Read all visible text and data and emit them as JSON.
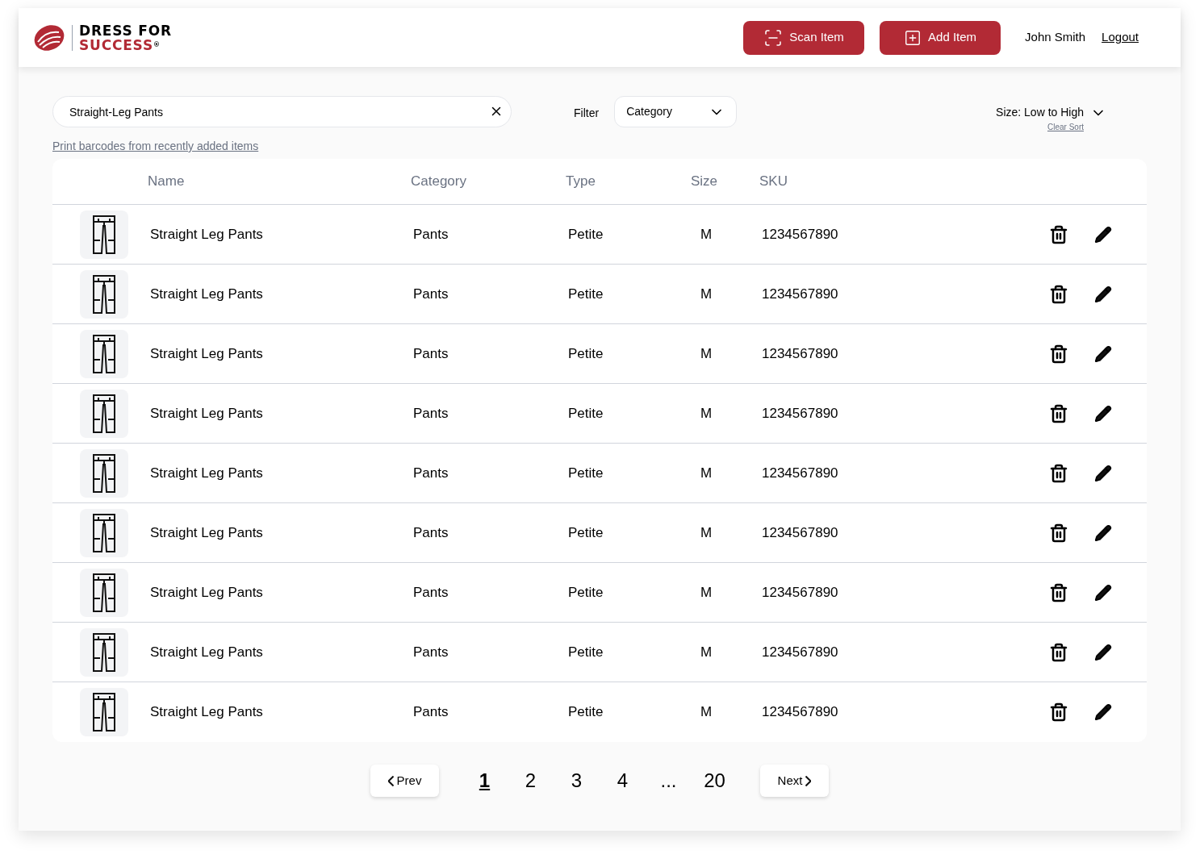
{
  "header": {
    "logo": {
      "line1": "DRESS FOR",
      "line2": "SUCCESS",
      "mark": "®"
    },
    "buttons": [
      {
        "kind": "scan",
        "label": "Scan Item"
      },
      {
        "kind": "add",
        "label": "Add Item"
      }
    ],
    "user": "John Smith",
    "logout": "Logout"
  },
  "search": {
    "value": "Straight-Leg Pants"
  },
  "filter": {
    "label": "Filter",
    "dropdown": "Category"
  },
  "sort": {
    "label": "Size: Low to High",
    "clear": "Clear Sort"
  },
  "print_link": "Print barcodes from recently added items",
  "table": {
    "columns": [
      "Name",
      "Category",
      "Type",
      "Size",
      "SKU"
    ],
    "rows": [
      {
        "name": "Straight Leg Pants",
        "category": "Pants",
        "type": "Petite",
        "size": "M",
        "sku": "1234567890"
      },
      {
        "name": "Straight Leg Pants",
        "category": "Pants",
        "type": "Petite",
        "size": "M",
        "sku": "1234567890"
      },
      {
        "name": "Straight Leg Pants",
        "category": "Pants",
        "type": "Petite",
        "size": "M",
        "sku": "1234567890"
      },
      {
        "name": "Straight Leg Pants",
        "category": "Pants",
        "type": "Petite",
        "size": "M",
        "sku": "1234567890"
      },
      {
        "name": "Straight Leg Pants",
        "category": "Pants",
        "type": "Petite",
        "size": "M",
        "sku": "1234567890"
      },
      {
        "name": "Straight Leg Pants",
        "category": "Pants",
        "type": "Petite",
        "size": "M",
        "sku": "1234567890"
      },
      {
        "name": "Straight Leg Pants",
        "category": "Pants",
        "type": "Petite",
        "size": "M",
        "sku": "1234567890"
      },
      {
        "name": "Straight Leg Pants",
        "category": "Pants",
        "type": "Petite",
        "size": "M",
        "sku": "1234567890"
      },
      {
        "name": "Straight Leg Pants",
        "category": "Pants",
        "type": "Petite",
        "size": "M",
        "sku": "1234567890"
      }
    ]
  },
  "pagination": {
    "prev": "Prev",
    "next": "Next",
    "pages": [
      {
        "label": "1",
        "selected": true
      },
      {
        "label": "2",
        "selected": false
      },
      {
        "label": "3",
        "selected": false
      },
      {
        "label": "4",
        "selected": false
      },
      {
        "label": "...",
        "selected": false
      },
      {
        "label": "20",
        "selected": false
      }
    ]
  }
}
